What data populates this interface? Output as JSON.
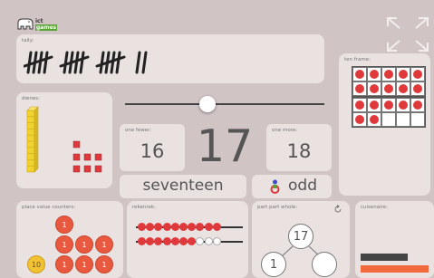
{
  "logo": {
    "top": "ict",
    "bottom": "games"
  },
  "tally": {
    "label": "tally:"
  },
  "ten_frame": {
    "label": "ten frame:",
    "frames": [
      10,
      7
    ]
  },
  "dienes": {
    "label": "dienes:",
    "tens": 1,
    "ones": 7
  },
  "slider": {
    "value": 17
  },
  "one_fewer": {
    "label": "one fewer:",
    "value": "16"
  },
  "number": {
    "value": "17"
  },
  "one_more": {
    "label": "one more:",
    "value": "18"
  },
  "number_word": "seventeen",
  "parity": "odd",
  "place_value_counters": {
    "label": "place value counters:",
    "one": "1",
    "ten": "10"
  },
  "rekenrek": {
    "label": "rekenrek:",
    "rows": [
      10,
      7
    ]
  },
  "part_part_whole": {
    "label": "part part whole:",
    "whole": "17",
    "part_a": "1",
    "part_b": ""
  },
  "cuisenaire": {
    "label": "cuisenaire:"
  },
  "colors": {
    "background": "#d1c4c5",
    "panel": "#eae1e1",
    "red": "#e0393c",
    "dienes": "#f2d230",
    "counter_red": "#e8593f",
    "counter_ten": "#f2c232"
  }
}
